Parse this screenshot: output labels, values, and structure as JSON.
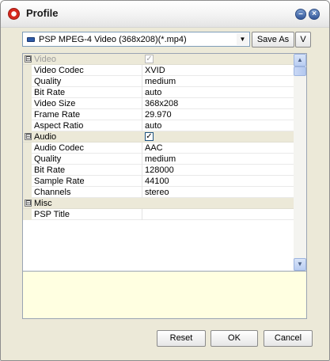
{
  "window": {
    "title": "Profile"
  },
  "profile": {
    "selected": "PSP MPEG-4 Video (368x208)(*.mp4)",
    "save_as_label": "Save As",
    "v_label": "V"
  },
  "grid": {
    "video": {
      "name": "Video",
      "enabled": true,
      "rows": [
        {
          "name": "Video Codec",
          "value": "XVID"
        },
        {
          "name": "Quality",
          "value": "medium"
        },
        {
          "name": "Bit Rate",
          "value": "auto"
        },
        {
          "name": "Video Size",
          "value": "368x208"
        },
        {
          "name": "Frame Rate",
          "value": "29.970"
        },
        {
          "name": "Aspect Ratio",
          "value": "auto"
        }
      ]
    },
    "audio": {
      "name": "Audio",
      "enabled": true,
      "rows": [
        {
          "name": "Audio Codec",
          "value": "AAC"
        },
        {
          "name": "Quality",
          "value": "medium"
        },
        {
          "name": "Bit Rate",
          "value": "128000"
        },
        {
          "name": "Sample Rate",
          "value": "44100"
        },
        {
          "name": "Channels",
          "value": "stereo"
        }
      ]
    },
    "misc": {
      "name": "Misc",
      "rows": [
        {
          "name": "PSP Title",
          "value": ""
        }
      ]
    },
    "expander_symbol": "⊟",
    "check_symbol": "✓"
  },
  "buttons": {
    "reset": "Reset",
    "ok": "OK",
    "cancel": "Cancel"
  },
  "icons": {
    "app": "converter-logo-icon",
    "minimize": "minimize-icon",
    "close": "close-icon"
  },
  "colors": {
    "window_bg": "#ece9d8",
    "description_bg": "#ffffe1",
    "category_bg": "#ece9d8"
  }
}
